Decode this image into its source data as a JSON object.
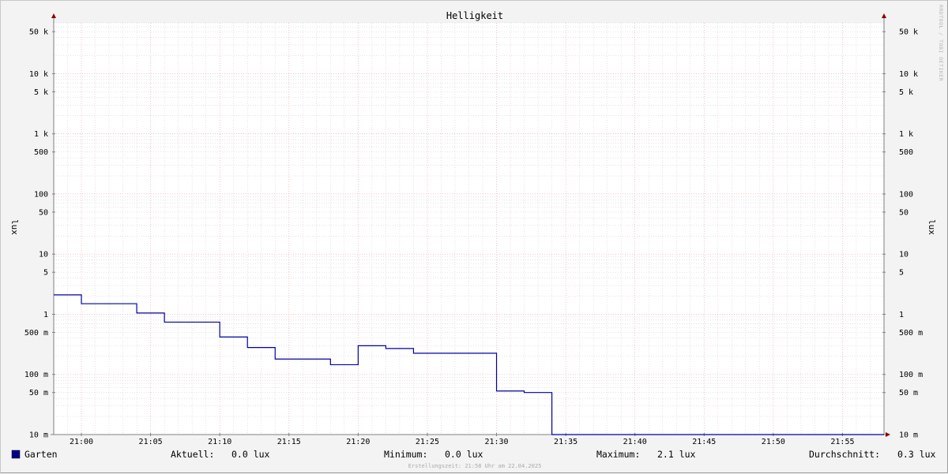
{
  "chart_data": {
    "type": "line",
    "title": "Helligkeit",
    "ylabel_left": "lux",
    "ylabel_right": "lux",
    "y_scale": "log",
    "ylim": [
      10,
      70000
    ],
    "x_range": [
      "20:58",
      "21:58"
    ],
    "grid": true,
    "legend_position": "bottom-left",
    "x_ticks": [
      "21:00",
      "21:05",
      "21:10",
      "21:15",
      "21:20",
      "21:25",
      "21:30",
      "21:35",
      "21:40",
      "21:45",
      "21:50",
      "21:55"
    ],
    "y_ticks": [
      {
        "value": 50000,
        "label": "50 k"
      },
      {
        "value": 10000,
        "label": "10 k"
      },
      {
        "value": 5000,
        "label": "5 k"
      },
      {
        "value": 1000,
        "label": "1 k"
      },
      {
        "value": 500,
        "label": "500"
      },
      {
        "value": 100,
        "label": "100"
      },
      {
        "value": 50,
        "label": "50"
      },
      {
        "value": 10,
        "label": "10"
      },
      {
        "value": 5,
        "label": "5"
      },
      {
        "value": 1,
        "label": "1"
      },
      {
        "value": 0.5,
        "label": "500 m"
      },
      {
        "value": 0.1,
        "label": "100 m"
      },
      {
        "value": 0.05,
        "label": "50 m"
      },
      {
        "value": 0.01,
        "label": "10 m"
      }
    ],
    "series": [
      {
        "name": "Garten",
        "color": "#00008b",
        "line_color": "#0000a0",
        "points": [
          {
            "x": "20:58",
            "y": 2.1
          },
          {
            "x": "21:00",
            "y": 1.5
          },
          {
            "x": "21:04",
            "y": 1.05
          },
          {
            "x": "21:06",
            "y": 0.74
          },
          {
            "x": "21:10",
            "y": 0.42
          },
          {
            "x": "21:12",
            "y": 0.28
          },
          {
            "x": "21:14",
            "y": 0.18
          },
          {
            "x": "21:18",
            "y": 0.145
          },
          {
            "x": "21:20",
            "y": 0.3
          },
          {
            "x": "21:22",
            "y": 0.27
          },
          {
            "x": "21:24",
            "y": 0.225
          },
          {
            "x": "21:30",
            "y": 0.053
          },
          {
            "x": "21:32",
            "y": 0.05
          },
          {
            "x": "21:34",
            "y": 0.01
          },
          {
            "x": "21:58",
            "y": 0.01
          }
        ]
      }
    ]
  },
  "legend": {
    "series_name": "Garten",
    "stats": [
      {
        "label": "Aktuell:",
        "value": "0.0 lux"
      },
      {
        "label": "Minimum:",
        "value": "0.0 lux"
      },
      {
        "label": "Maximum:",
        "value": "2.1 lux"
      },
      {
        "label": "Durchschnitt:",
        "value": "0.3 lux"
      }
    ]
  },
  "watermark": "RRDTOOL / TOBI OETIKER",
  "footer": "Erstellungszeit: 21:58 Uhr am 22.04.2025",
  "colors": {
    "background": "#f3f3f3",
    "plot_background": "#ffffff",
    "minor_grid": "#c8c8c8",
    "major_grid": "#e8a0a0",
    "axis": "#808080",
    "arrow": "#8b0000"
  }
}
